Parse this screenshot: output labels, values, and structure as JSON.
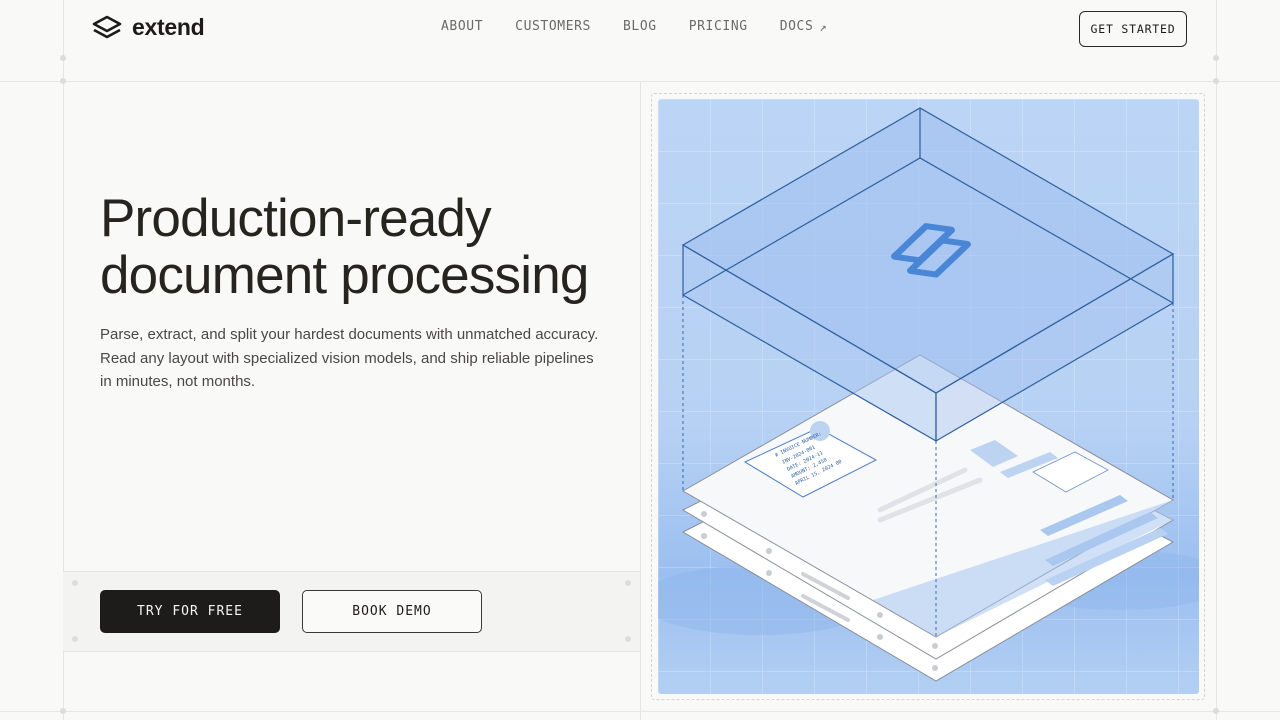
{
  "brand": {
    "name": "extend"
  },
  "nav": {
    "items": [
      {
        "label": "ABOUT"
      },
      {
        "label": "CUSTOMERS"
      },
      {
        "label": "BLOG"
      },
      {
        "label": "PRICING"
      },
      {
        "label": "DOCS",
        "icon": "external-arrow-icon",
        "glyph": "↗"
      }
    ]
  },
  "header": {
    "cta_label": "GET STARTED"
  },
  "hero": {
    "title_line1": "Production-ready",
    "title_line2": "document processing",
    "subtitle": "Parse, extract, and split your hardest documents with unmatched accuracy. Read any layout with specialized vision models, and ship reliable pipelines in minutes, not months.",
    "primary_cta": "TRY FOR FREE",
    "secondary_cta": "BOOK DEMO"
  },
  "illustration": {
    "card_lines": [
      "# INVOICE NUMBER:",
      "INV-2024-001",
      "DATE: 2024-11",
      "AMOUNT: 2,450",
      "APRIL 15, 2024 00"
    ],
    "colors": {
      "accent": "#4a86d6",
      "sky": "#b9d3f5",
      "line": "#2e5f9e"
    }
  }
}
